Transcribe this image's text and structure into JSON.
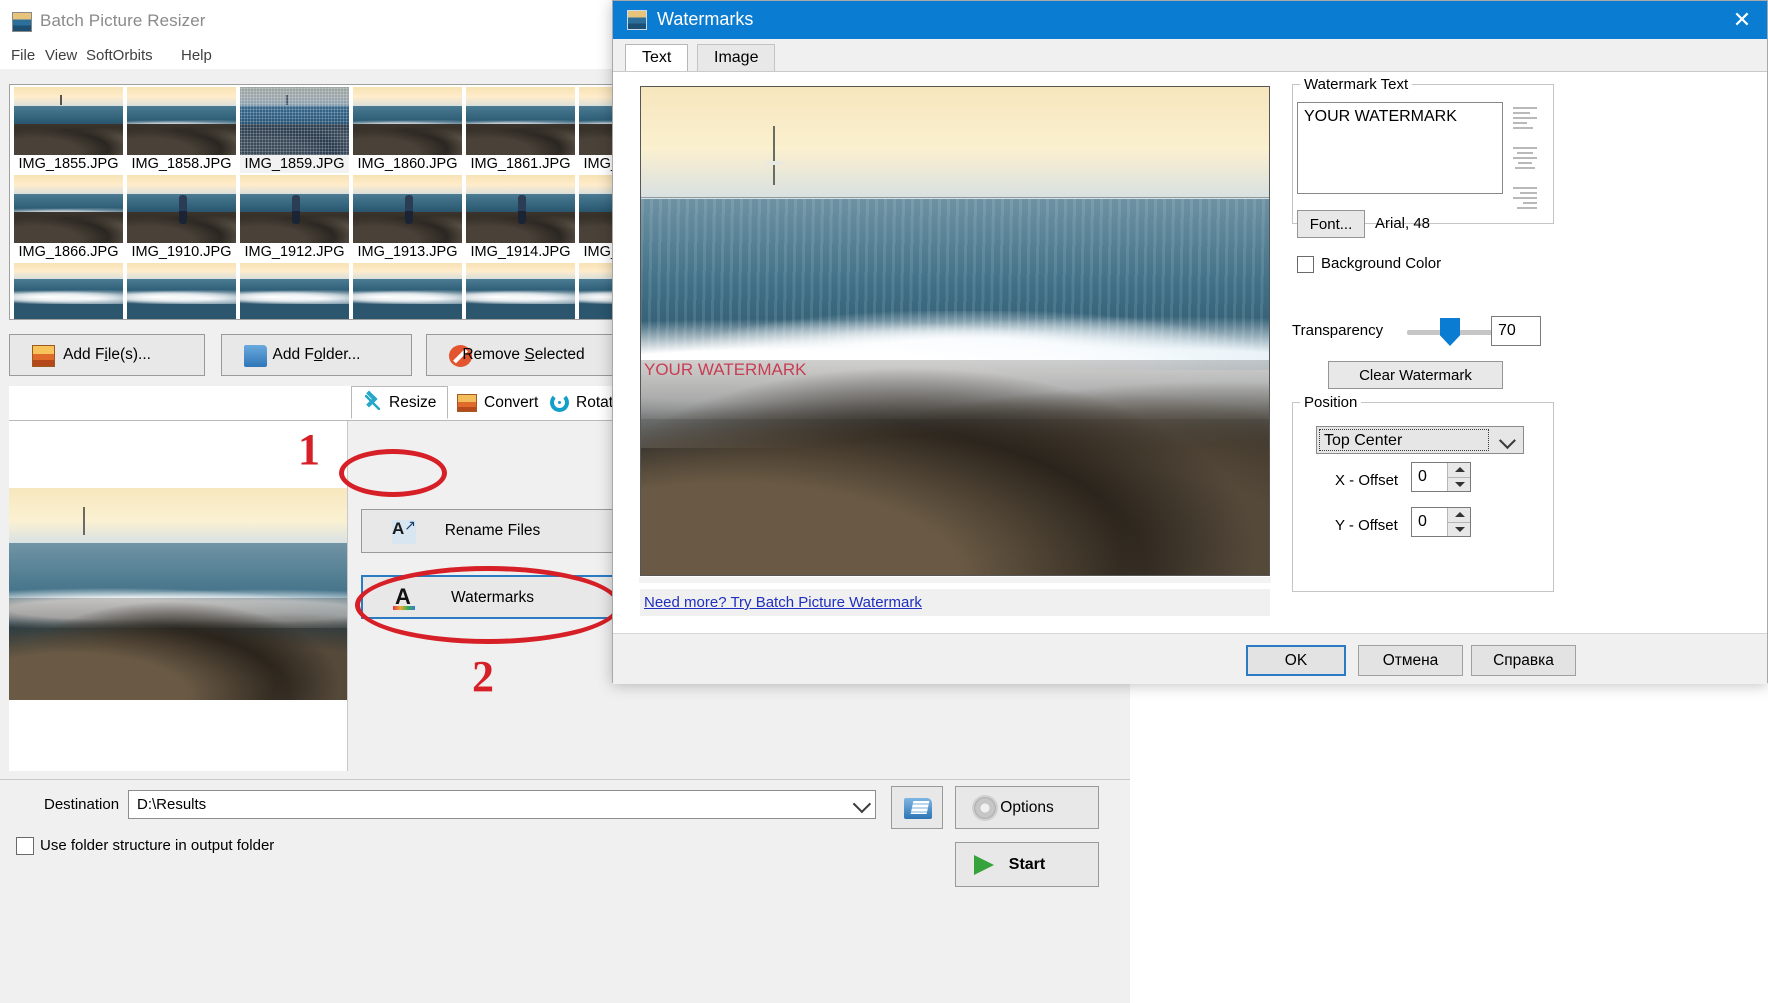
{
  "main_window": {
    "title": "Batch Picture Resizer",
    "icon": "app-icon",
    "menu": [
      "File",
      "View",
      "SoftOrbits",
      "Help"
    ],
    "thumbnails": [
      {
        "name": "IMG_1855.JPG",
        "selected": false,
        "kind": "rocks"
      },
      {
        "name": "IMG_1858.JPG",
        "selected": false,
        "kind": "wave"
      },
      {
        "name": "IMG_1859.JPG",
        "selected": true,
        "kind": "rocks"
      },
      {
        "name": "IMG_1860.JPG",
        "selected": false,
        "kind": "wave"
      },
      {
        "name": "IMG_1861.JPG",
        "selected": false,
        "kind": "wave"
      },
      {
        "name": "IMG_1866.JPG",
        "selected": false,
        "kind": "wave"
      },
      {
        "name": "IMG_1910.JPG",
        "selected": false,
        "kind": "person"
      },
      {
        "name": "IMG_1912.JPG",
        "selected": false,
        "kind": "person"
      },
      {
        "name": "IMG_1913.JPG",
        "selected": false,
        "kind": "person"
      },
      {
        "name": "IMG_1914.JPG",
        "selected": false,
        "kind": "person"
      }
    ],
    "file_buttons": [
      {
        "label_pre": "Add F",
        "label_mnemonic": "i",
        "label_post": "le(s)...",
        "name": "add-files"
      },
      {
        "label_pre": "Add F",
        "label_mnemonic": "o",
        "label_post": "lder...",
        "name": "add-folder"
      },
      {
        "label_pre": "Remove ",
        "label_mnemonic": "S",
        "label_post": "elected",
        "name": "remove-selected"
      }
    ],
    "tool_tabs": [
      {
        "label": "Resize",
        "active": true
      },
      {
        "label": "Convert",
        "active": false
      },
      {
        "label": "Rotate",
        "active": false
      }
    ],
    "option_buttons": [
      {
        "label": "Rename Files",
        "focused": false
      },
      {
        "label": "Watermarks",
        "focused": true
      }
    ],
    "annotations": [
      {
        "text": "1",
        "target": "resize-tab"
      },
      {
        "text": "2",
        "target": "watermarks-button"
      }
    ],
    "destination": {
      "label": "Destination",
      "value": "D:\\Results",
      "browse_icon": "open-folder-icon"
    },
    "options_button": "Options",
    "start_button": "Start",
    "folder_structure_checkbox": {
      "label": "Use folder structure in output folder",
      "checked": false
    }
  },
  "dialog": {
    "title": "Watermarks",
    "close_glyph": "✕",
    "tabs": [
      {
        "label": "Text",
        "active": true
      },
      {
        "label": "Image",
        "active": false
      }
    ],
    "preview_watermark_text": "YOUR WATERMARK",
    "promo_link": "Need more? Try Batch Picture Watermark",
    "watermark_text_group": {
      "title": "Watermark Text",
      "value": "YOUR WATERMARK",
      "font_button": "Font...",
      "font_value": "Arial, 48",
      "background_color_checkbox": {
        "label": "Background Color",
        "checked": false
      },
      "align_icons": [
        "align-left-icon",
        "align-center-icon",
        "align-right-icon"
      ]
    },
    "transparency": {
      "label": "Transparency",
      "value": "70",
      "min": 0,
      "max": 100,
      "thumb_color": "#0a7cd1"
    },
    "clear_button": "Clear Watermark",
    "position_group": {
      "title": "Position",
      "selected": "Top Center",
      "x_offset": {
        "label": "X - Offset",
        "value": "0"
      },
      "y_offset": {
        "label": "Y - Offset",
        "value": "0"
      }
    },
    "buttons": [
      {
        "label": "OK",
        "default": true
      },
      {
        "label": "Отмена",
        "default": false
      },
      {
        "label": "Справка",
        "default": false
      }
    ]
  },
  "colors": {
    "titlebar_blue": "#0a7cd1",
    "focus_blue": "#2b7ac4",
    "annotation_red": "#d61f26",
    "link_blue": "#1f2fbf",
    "watermark_red": "#c8324a"
  }
}
